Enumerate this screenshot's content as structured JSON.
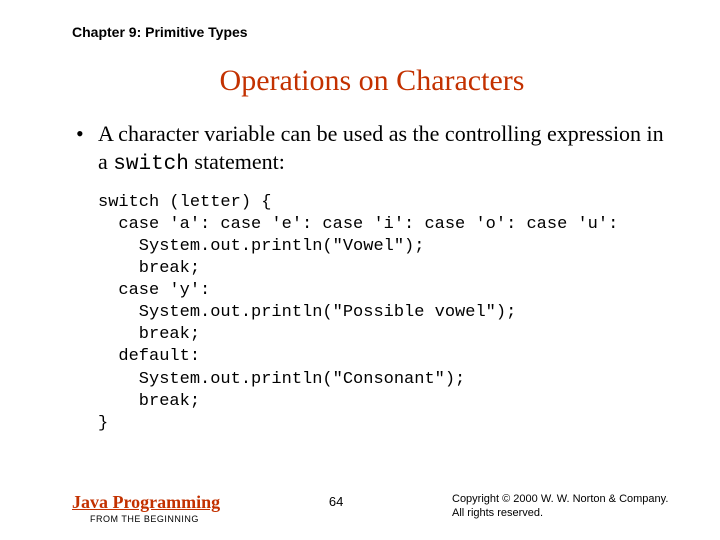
{
  "chapter": "Chapter 9: Primitive Types",
  "title": "Operations on Characters",
  "bullet": {
    "pre": "A character variable can be used as the controlling expression in a ",
    "code": "switch",
    "post": " statement:"
  },
  "code": "switch (letter) {\n  case 'a': case 'e': case 'i': case 'o': case 'u':\n    System.out.println(\"Vowel\");\n    break;\n  case 'y':\n    System.out.println(\"Possible vowel\");\n    break;\n  default:\n    System.out.println(\"Consonant\");\n    break;\n}",
  "footer": {
    "book_title": "Java Programming",
    "book_sub": "FROM THE BEGINNING",
    "page": "64",
    "copyright1": "Copyright © 2000 W. W. Norton & Company.",
    "copyright2": "All rights reserved."
  }
}
